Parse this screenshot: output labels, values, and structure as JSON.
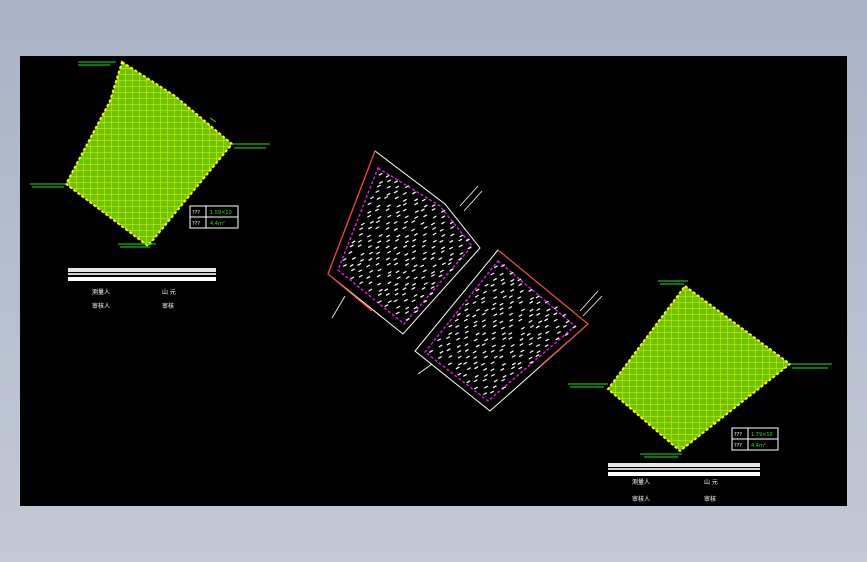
{
  "colors": {
    "background": "#000000",
    "frame": "#aab3c5",
    "hatch": "#7fd400",
    "outline": "#ffff00",
    "label": "#19e619",
    "road": "#ff3b3b",
    "boundary": "#d21ed2",
    "points": "#ffffff",
    "titlebar": "#ffffff"
  },
  "table_left": {
    "row1_key": "???",
    "row1_val": "1.59×10",
    "row2_key": "???",
    "row2_val": "4.4m²"
  },
  "table_right": {
    "row1_key": "???",
    "row1_val": "1.79×10",
    "row2_key": "???",
    "row2_val": "4.4m²"
  },
  "caption_left": {
    "l1a": "测量人",
    "l1b": "山 元",
    "l2a": "审核人",
    "l2b": "审核"
  },
  "caption_right": {
    "l1a": "测量人",
    "l1b": "山 元",
    "l2a": "审核人",
    "l2b": "审核"
  }
}
